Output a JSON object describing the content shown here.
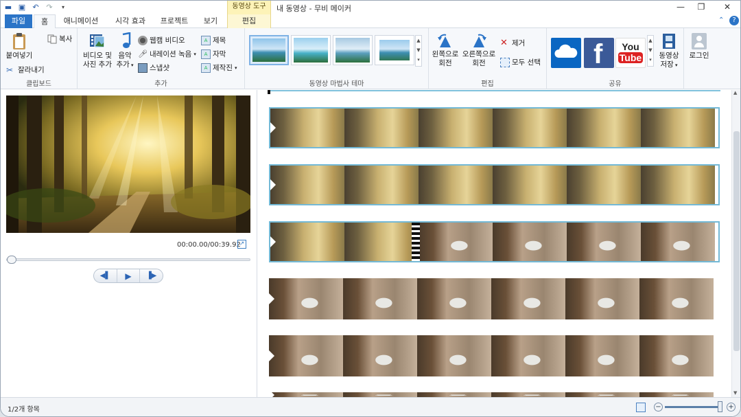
{
  "app": {
    "title": "내 동영상 - 무비 메이커",
    "context_tab_group": "동영상 도구"
  },
  "tabs": [
    {
      "label": "파일"
    },
    {
      "label": "홈"
    },
    {
      "label": "애니메이션"
    },
    {
      "label": "시각 효과"
    },
    {
      "label": "프로젝트"
    },
    {
      "label": "보기"
    },
    {
      "label": "편집"
    }
  ],
  "ribbon": {
    "clipboard": {
      "label": "클립보드",
      "paste": "붙여넣기",
      "copy": "복사",
      "cut": "잘라내기"
    },
    "add": {
      "label": "추가",
      "add_video_1": "비디오 및",
      "add_video_2": "사진 추가",
      "music_1": "음악",
      "music_2": "추가",
      "webcam": "웹캠 비디오",
      "narration": "내레이션 녹음",
      "snapshot": "스냅샷",
      "title": "제목",
      "caption": "자막",
      "credits": "제작진"
    },
    "themes": {
      "label": "동영상 마법사 테마"
    },
    "edit": {
      "label": "편집",
      "rotate_left_1": "왼쪽으로",
      "rotate_left_2": "회전",
      "rotate_right_1": "오른쪽으로",
      "rotate_right_2": "회전",
      "remove": "제거",
      "select_all": "모두 선택"
    },
    "share": {
      "label": "공유",
      "save_movie_1": "동영상",
      "save_movie_2": "저장",
      "signin": "로그인",
      "youtube_1": "You",
      "youtube_2": "Tube"
    }
  },
  "preview": {
    "time": "00:00.00/00:39.92",
    "progress": 0
  },
  "status": {
    "items": "1/2개 항목"
  },
  "colors": {
    "file_tab": "#2b74c7",
    "context_tab": "#fdf3b8",
    "selection": "#73b9d6"
  }
}
